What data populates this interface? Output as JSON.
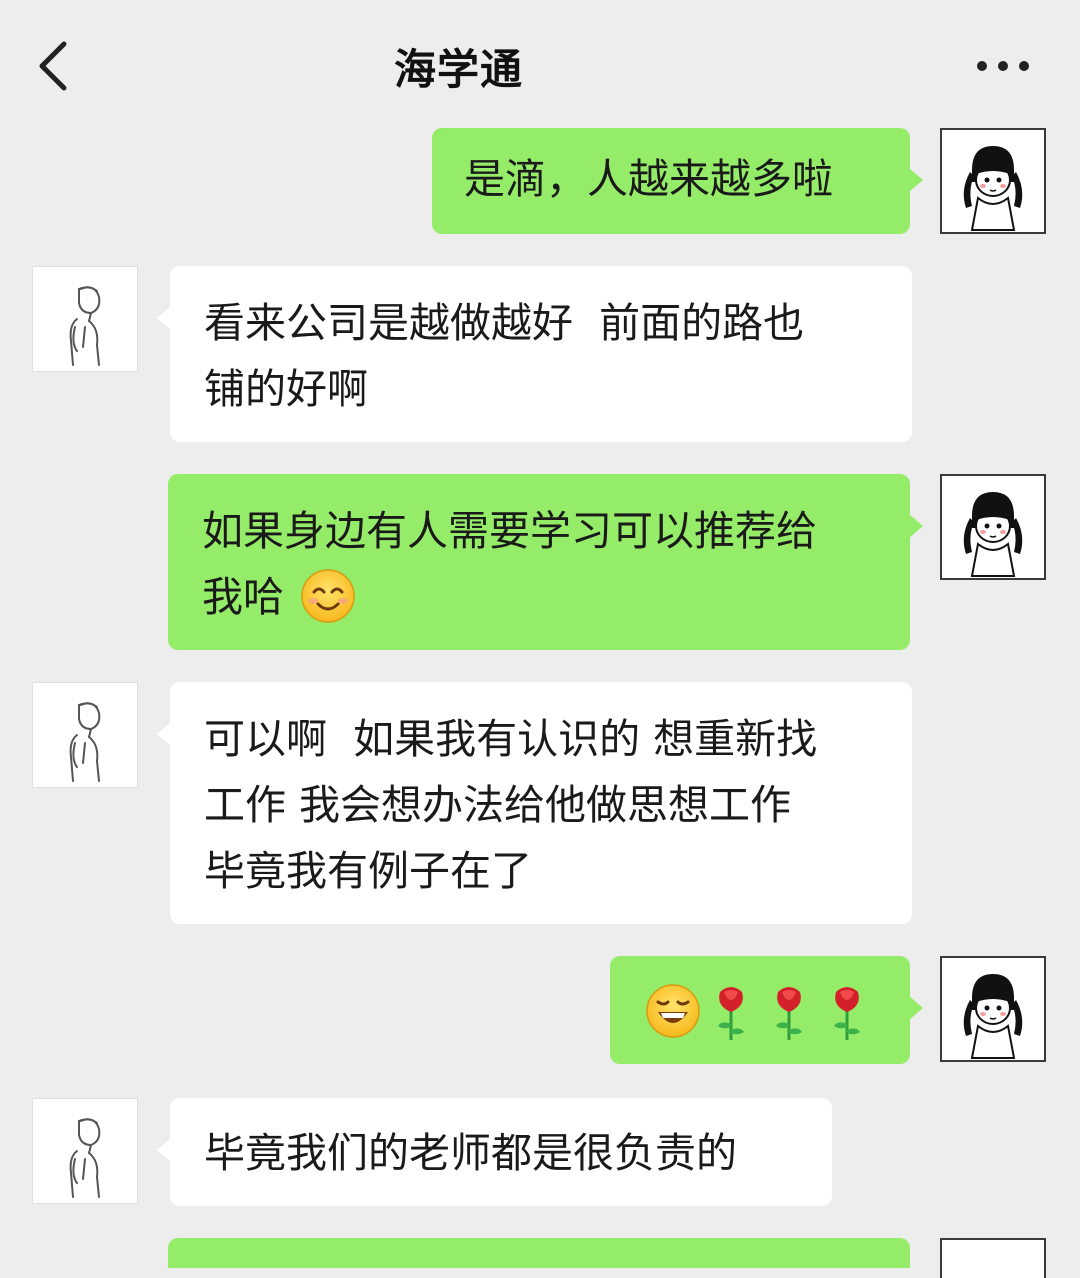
{
  "header": {
    "title": "海学通"
  },
  "messages": [
    {
      "id": "m1",
      "side": "right",
      "text": "是滴，人越来越多啦"
    },
    {
      "id": "m2",
      "side": "left",
      "lines": [
        "看来公司是越做越好  前面的路也",
        "铺的好啊"
      ]
    },
    {
      "id": "m3",
      "side": "right",
      "lines": [
        "如果身边有人需要学习可以推荐给",
        "我哈"
      ],
      "emoji": "smiling-face-emoji"
    },
    {
      "id": "m4",
      "side": "left",
      "lines": [
        "可以啊  如果我有认识的 想重新找",
        "工作 我会想办法给他做思想工作",
        "毕竟我有例子在了"
      ]
    },
    {
      "id": "m5",
      "side": "right",
      "emojis": [
        "grinning-squint-emoji",
        "rose-emoji",
        "rose-emoji",
        "rose-emoji"
      ]
    },
    {
      "id": "m6",
      "side": "left",
      "text": "毕竟我们的老师都是很负责的"
    }
  ],
  "colors": {
    "background": "#ededed",
    "self_bubble": "#95ec69",
    "other_bubble": "#ffffff"
  }
}
